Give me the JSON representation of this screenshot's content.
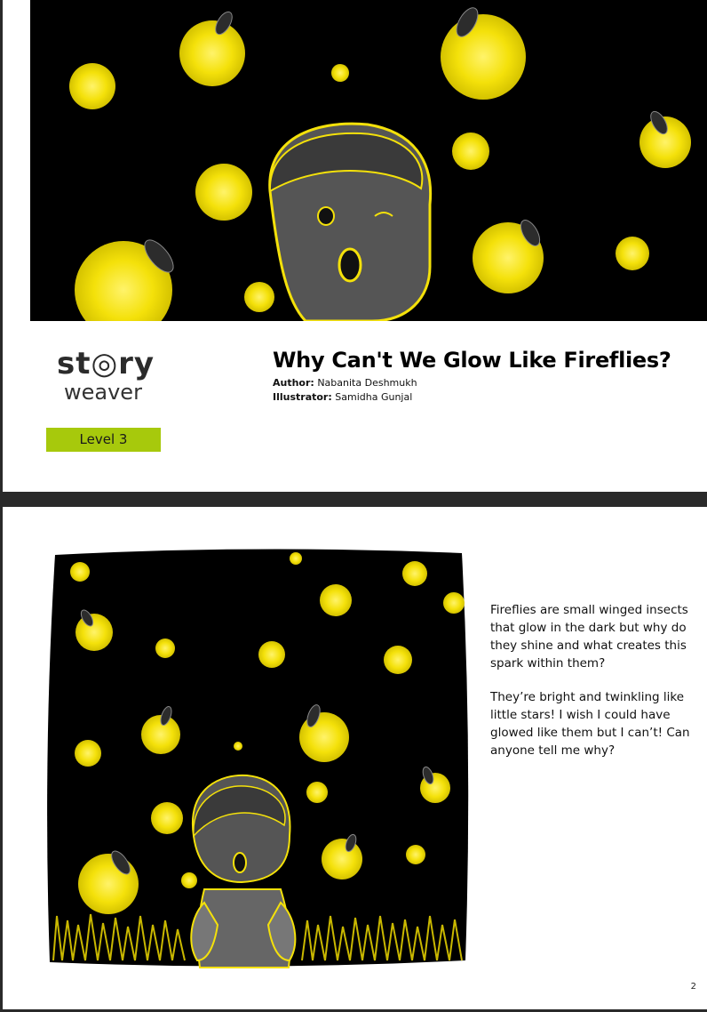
{
  "cover": {
    "logo_line1": "st◎ry",
    "logo_line2": "weaver",
    "level": "Level 3",
    "title": "Why Can't We Glow Like Fireflies?",
    "author_label": "Author:",
    "author": "Nabanita Deshmukh",
    "illustrator_label": "Illustrator:",
    "illustrator": "Samidha Gunjal"
  },
  "page2": {
    "paragraphs": [
      "Fireflies are small winged insects that glow in the dark but why do they shine and what creates this spark within them?",
      "They’re bright and twinkling like little stars! I wish I could have glowed like them but I can’t! Can anyone tell me why?"
    ],
    "page_number": "2"
  },
  "colors": {
    "accent_level": "#a7c90c",
    "firefly_glow": "#f4e10a",
    "night_bg": "#000000"
  }
}
